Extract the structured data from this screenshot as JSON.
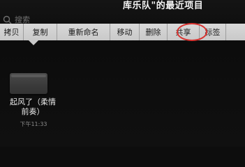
{
  "header": {
    "title": "库乐队\"的最近项目"
  },
  "search": {
    "placeholder": "搜索"
  },
  "menu": {
    "items": [
      {
        "label": "拷贝"
      },
      {
        "label": "复制"
      },
      {
        "label": "重新命名"
      },
      {
        "label": "移动"
      },
      {
        "label": "删除"
      },
      {
        "label": "共享",
        "highlighted": true
      },
      {
        "label": "标签"
      },
      {
        "label": ""
      }
    ]
  },
  "highlight_color": "#d9322f",
  "file": {
    "name_line1": "起风了（柔情",
    "name_line2": "前奏）",
    "time": "下午11:33"
  }
}
